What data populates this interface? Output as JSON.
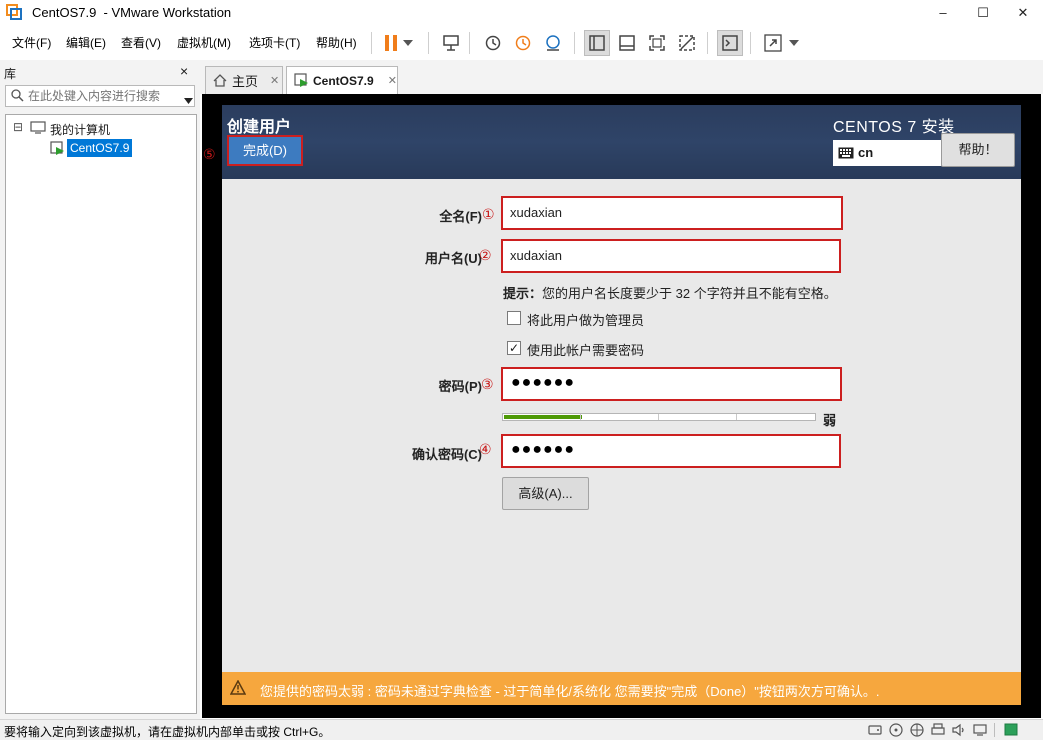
{
  "window": {
    "title": "CentOS7.9  - VMware Workstation",
    "minimize": "–",
    "maximize": "☐",
    "close": "✕"
  },
  "menu": {
    "items": [
      "文件(F)",
      "编辑(E)",
      "查看(V)",
      "虚拟机(M)",
      "选项卡(T)",
      "帮助(H)"
    ]
  },
  "library": {
    "title": "库",
    "close": "×",
    "search_placeholder": "在此处键入内容进行搜索",
    "tree": {
      "root_label": "我的计算机",
      "expander": "⊟",
      "child_label": "CentOS7.9"
    }
  },
  "tabs": [
    {
      "label": "主页",
      "close": "✕"
    },
    {
      "label": "CentOS7.9",
      "close": "✕"
    }
  ],
  "installer": {
    "header_title": "创建用户",
    "product_title": "CENTOS 7 安装",
    "done_label": "完成(D)",
    "done_marker": "⑤",
    "keyboard_layout": "cn",
    "help_label": "帮助！",
    "fullname_label": "全名(F)",
    "fullname_marker": "①",
    "fullname_value": "xudaxian",
    "username_label": "用户名(U)",
    "username_marker": "②",
    "username_value": "xudaxian",
    "hint_prefix": "提示：",
    "hint_text": "您的用户名长度要少于 32 个字符并且不能有空格。",
    "admin_checkbox_label": "将此用户做为管理员",
    "admin_checked": false,
    "require_password_label": "使用此帐户需要密码",
    "require_password_checked": true,
    "check_mark": "✓",
    "password_label": "密码(P)",
    "password_marker": "③",
    "password_masked": "●●●●●●",
    "strength_text": "弱",
    "strength_fraction": 0.25,
    "confirm_label": "确认密码(C)",
    "confirm_marker": "④",
    "confirm_masked": "●●●●●●",
    "advanced_label": "高级(A)...",
    "warning_text": "您提供的密码太弱 : 密码未通过字典检查 - 过于简单化/系统化 您需要按\"完成（Done）\"按钮两次方可确认。.",
    "warning_icon": "⚠"
  },
  "statusbar": {
    "text": "要将输入定向到该虚拟机，请在虚拟机内部单击或按 Ctrl+G。"
  },
  "colors": {
    "accent_blue": "#3d7bc0",
    "highlight_red": "#cc1f1f",
    "warning_orange": "#f6a73e",
    "strength_green": "#4e9a06",
    "selection_blue": "#0078d7"
  },
  "icons": {
    "app": "vmware-icon",
    "pause": "pause-icon",
    "home": "home-icon",
    "vm": "vm-icon",
    "keyboard": "keyboard-icon",
    "search": "search-icon",
    "warning": "warning-icon"
  }
}
